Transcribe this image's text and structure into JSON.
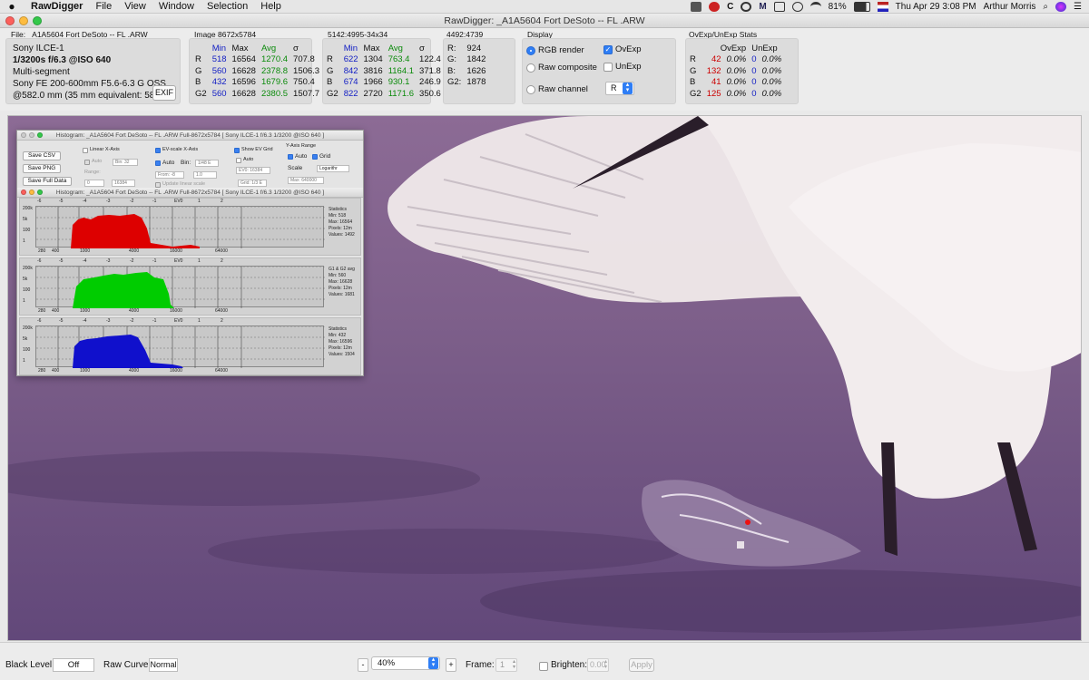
{
  "menubar": {
    "apple": "",
    "app_name": "RawDigger",
    "menus": [
      "File",
      "View",
      "Window",
      "Selection",
      "Help"
    ],
    "battery": "81%",
    "datetime": "Thu Apr 29  3:08 PM",
    "user": "Arthur Morris"
  },
  "window": {
    "title": "RawDigger: _A1A5604 Fort DeSoto -- FL .ARW"
  },
  "file_panel": {
    "heading": "File: _A1A5604 Fort DeSoto -- FL .ARW",
    "camera": "Sony ILCE-1",
    "exposure": "1/3200s f/6.3 @ISO 640",
    "metering": "Multi-segment",
    "lens": "Sony FE 200-600mm F5.6-6.3 G OSS",
    "focal": "@582.0 mm (35 mm equivalent: 582.0",
    "exif_button": "EXIF"
  },
  "image_stats": {
    "heading": "Image 8672x5784",
    "headers": [
      "",
      "Min",
      "Max",
      "Avg",
      "σ"
    ],
    "rows": [
      [
        "R",
        "518",
        "16564",
        "1270.4",
        "707.8"
      ],
      [
        "G",
        "560",
        "16628",
        "2378.8",
        "1506.3"
      ],
      [
        "B",
        "432",
        "16596",
        "1679.6",
        "750.4"
      ],
      [
        "G2",
        "560",
        "16628",
        "2380.5",
        "1507.7"
      ]
    ]
  },
  "sel_stats": {
    "heading": "5142:4995-34x34",
    "headers": [
      "",
      "Min",
      "Max",
      "Avg",
      "σ"
    ],
    "rows": [
      [
        "R",
        "622",
        "1304",
        "763.4",
        "122.4"
      ],
      [
        "G",
        "842",
        "3816",
        "1164.1",
        "371.8"
      ],
      [
        "B",
        "674",
        "1966",
        "930.1",
        "246.9"
      ],
      [
        "G2",
        "822",
        "2720",
        "1171.6",
        "350.6"
      ]
    ]
  },
  "pixel": {
    "heading": "4492:4739",
    "rows": [
      [
        "R:",
        "924"
      ],
      [
        "G:",
        "1842"
      ],
      [
        "B:",
        "1626"
      ],
      [
        "G2:",
        "1878"
      ]
    ]
  },
  "display": {
    "heading": "Display",
    "rgb_render": "RGB render",
    "raw_composite": "Raw composite",
    "raw_channel": "Raw channel",
    "ovexp": "OvExp",
    "unexp": "UnExp",
    "channel_value": "R"
  },
  "ovexp_stats": {
    "heading": "OvExp/UnExp Stats",
    "headers": [
      "",
      "OvExp",
      "",
      "UnExp",
      ""
    ],
    "rows": [
      [
        "R",
        "42",
        "0.0%",
        "0",
        "0.0%"
      ],
      [
        "G",
        "132",
        "0.0%",
        "0",
        "0.0%"
      ],
      [
        "B",
        "41",
        "0.0%",
        "0",
        "0.0%"
      ],
      [
        "G2",
        "125",
        "0.0%",
        "0",
        "0.0%"
      ]
    ]
  },
  "histogram": {
    "title_back": "Histogram: _A1A5604 Fort DeSoto -- FL .ARW Full-8672x5784 [ Sony ILCE-1 f/6.3 1/3200 @ISO 640 ]",
    "title_front": "Histogram: _A1A5604 Fort DeSoto -- FL .ARW Full-8672x5784 [ Sony ILCE-1 f/6.3 1/3200 @ISO 640 ]",
    "save_csv": "Save CSV",
    "save_png": "Save PNG",
    "save_full": "Save Full Data",
    "linear_x": "Linear X-Axis",
    "auto": "Auto",
    "bin_dim": "Bin: 32",
    "range": "Range:",
    "range_from": "0",
    "range_to": "16384",
    "ev_x": "EV-scale X-Axis",
    "ev_auto": "Auto",
    "bin": "Bin:",
    "bin_val": "1/48 E",
    "from": "From: -8",
    "to": "1.0",
    "update_linear": "Update linear scale",
    "show_ev": "Show EV Grid",
    "ev_auto2": "Auto",
    "ev0": "EV0: 16384",
    "grid": "Grid: 1/3 E",
    "y_range": "Y-Axis Range",
    "y_auto": "Auto",
    "y_grid": "Grid",
    "scale": "Scale",
    "scale_val": "Logarithr",
    "max": "Max: 640000",
    "ylabels": [
      "200k",
      "5k",
      "100",
      "1"
    ],
    "xlabels": [
      "280",
      "400",
      "1000",
      "4000",
      "16000",
      "64000"
    ],
    "evlabels": [
      "-6",
      "-5",
      "-4",
      "-3",
      "-2",
      "-1",
      "EV0",
      "1",
      "2"
    ],
    "rows": [
      {
        "color": "#dd0000",
        "stats": "Statistics\nMin: 518\nMax: 16564\nPixels: 12m\nValues: 1492"
      },
      {
        "color": "#00cc00",
        "stats": "G1 & G2 avg\nMin: 560\nMax: 16628\nPixels: 12m\nValues: 1681"
      },
      {
        "color": "#1010cc",
        "stats": "Statistics\nMin: 432\nMax: 16596\nPixels: 12m\nValues: 1504"
      }
    ]
  },
  "bottom": {
    "black_level_label": "Black Level:",
    "black_level_value": "Off",
    "raw_curve_label": "Raw Curve:",
    "raw_curve_value": "Normal",
    "minus": "-",
    "zoom": "40%",
    "plus": "+",
    "frame_label": "Frame:",
    "frame_value": "1",
    "brighten_label": "Brighten:",
    "brighten_value": "0.00",
    "apply": "Apply"
  },
  "colors": {
    "accent": "#2f7ef5",
    "min_blue": "#1420c4",
    "avg_green": "#0a8a0a",
    "ovexp_red": "#cc0000"
  }
}
